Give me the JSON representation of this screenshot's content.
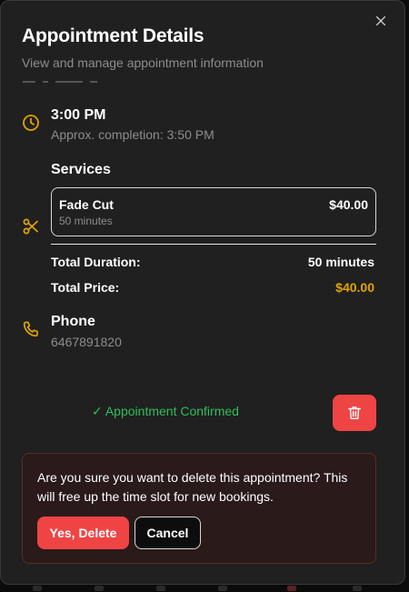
{
  "dialog": {
    "title": "Appointment Details",
    "subtitle": "View and manage appointment information",
    "close_icon": "close-icon"
  },
  "time": {
    "icon": "clock-icon",
    "value": "3:00 PM",
    "completion": "Approx. completion: 3:50 PM"
  },
  "services": {
    "icon": "scissors-icon",
    "heading": "Services",
    "items": [
      {
        "name": "Fade Cut",
        "duration": "50 minutes",
        "price": "$40.00"
      }
    ],
    "total_duration_label": "Total Duration:",
    "total_duration_value": "50 minutes",
    "total_price_label": "Total Price:",
    "total_price_value": "$40.00"
  },
  "phone": {
    "icon": "phone-icon",
    "label": "Phone",
    "value": "6467891820"
  },
  "status": {
    "text": "✓ Appointment Confirmed",
    "color": "#2fbf5a"
  },
  "delete_button": {
    "icon": "trash-icon",
    "color": "#ef4444"
  },
  "delete_confirm": {
    "message": "Are you sure you want to delete this appointment? This will free up the time slot for new bookings.",
    "yes_label": "Yes, Delete",
    "cancel_label": "Cancel"
  },
  "colors": {
    "accent": "#e0a400",
    "danger": "#ef4444",
    "background": "#202020"
  }
}
